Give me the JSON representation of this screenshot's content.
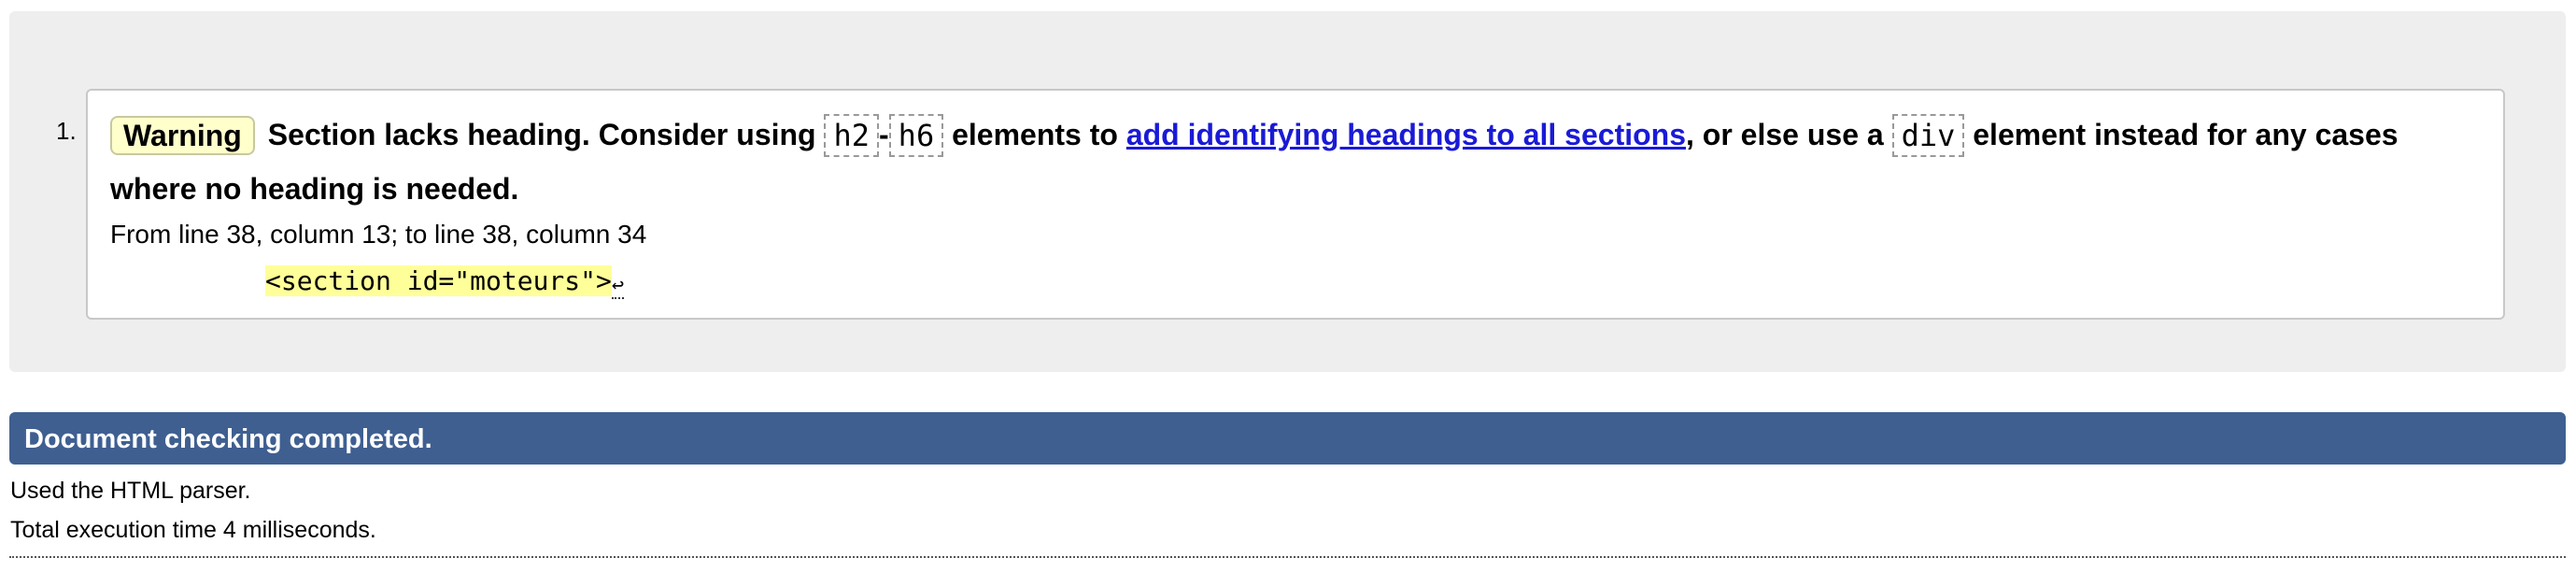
{
  "messages": [
    {
      "number": "1.",
      "type": "Warning",
      "text_1": "Section lacks heading. Consider using",
      "code_h2": "h2",
      "dash": "-",
      "code_h6": "h6",
      "text_2": "elements to",
      "link": "add identifying headings to all sections",
      "text_3": ", or else use a",
      "code_div": "div",
      "text_4": "element instead for any cases where no heading is needed.",
      "location": "From line 38, column 13; to line 38, column 34",
      "source": "<section id=\"moteurs\">",
      "return_symbol": "↩"
    }
  ],
  "status": {
    "title": "Document checking completed.",
    "parser": "Used the HTML parser.",
    "time": "Total execution time 4 milliseconds."
  },
  "colors": {
    "panel_bg": "#eeeeee",
    "status_bg": "#3f5f91",
    "warning_bg": "#ffffcc",
    "highlight": "#ffff99",
    "link": "#1a1ad6"
  }
}
